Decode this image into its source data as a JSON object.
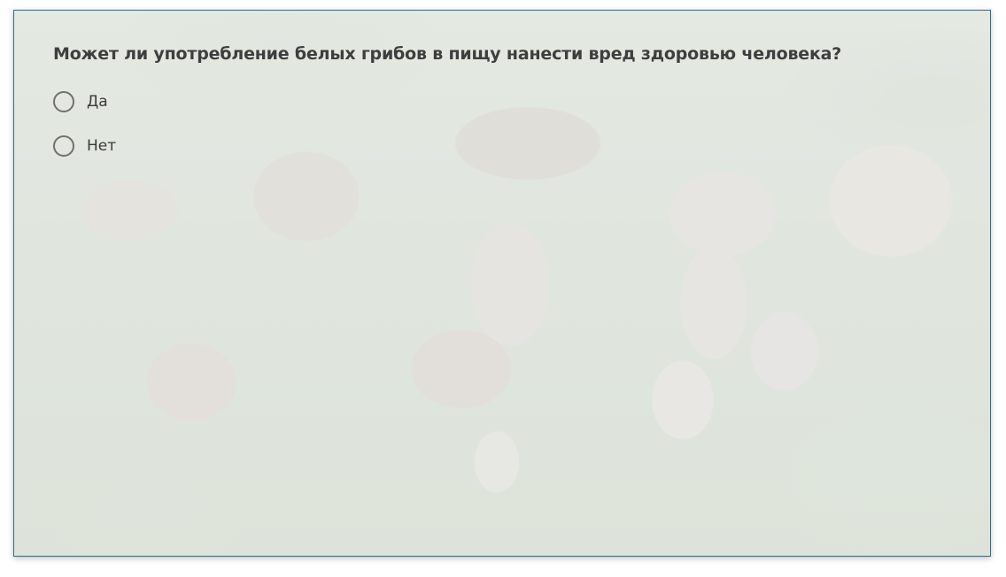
{
  "quiz": {
    "question": "Может ли употребление белых грибов в пищу нанести вред здоровью человека?",
    "options": [
      {
        "label": "Да",
        "selected": false
      },
      {
        "label": "Нет",
        "selected": false
      }
    ]
  },
  "colors": {
    "frame_border": "#2c6f8c",
    "question_text": "#3e3e3e",
    "radio_border": "#707070"
  }
}
